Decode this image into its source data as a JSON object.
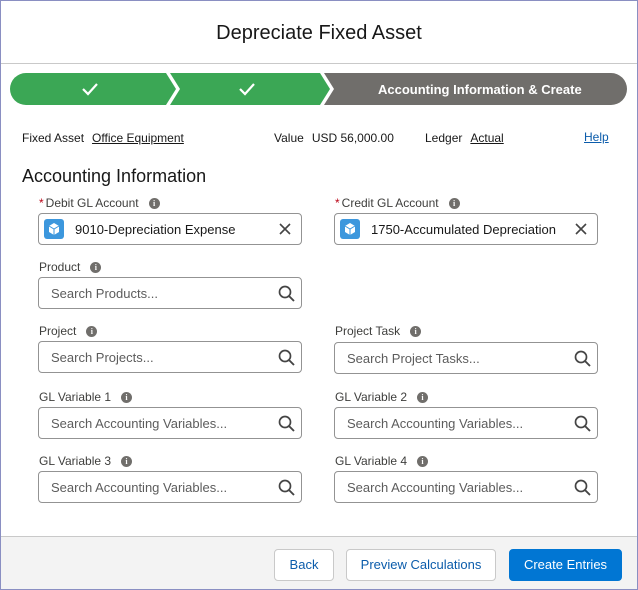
{
  "modal": {
    "title": "Depreciate Fixed Asset"
  },
  "path": {
    "steps": [
      {
        "state": "complete",
        "label": "",
        "icon": "check-icon"
      },
      {
        "state": "complete",
        "label": "",
        "icon": "check-icon"
      },
      {
        "state": "current",
        "label": "Accounting Information & Create"
      }
    ],
    "colors": {
      "complete": "#3ba755",
      "current": "#706e6b"
    }
  },
  "summary": {
    "fixed_asset_label": "Fixed Asset",
    "fixed_asset_value": "Office Equipment",
    "value_label": "Value",
    "value_amount": "USD 56,000.00",
    "ledger_label": "Ledger",
    "ledger_value": "Actual",
    "help_label": "Help"
  },
  "section": {
    "title": "Accounting Information"
  },
  "fields": {
    "debit_gl": {
      "label": "Debit GL Account",
      "required": "*",
      "value": "9010-Depreciation Expense"
    },
    "credit_gl": {
      "label": "Credit GL Account",
      "required": "*",
      "value": "1750-Accumulated Depreciation"
    },
    "product": {
      "label": "Product",
      "placeholder": "Search Products..."
    },
    "project": {
      "label": "Project",
      "placeholder": "Search Projects..."
    },
    "project_task": {
      "label": "Project Task",
      "placeholder": "Search Project Tasks..."
    },
    "gl_var_1": {
      "label": "GL Variable 1",
      "placeholder": "Search Accounting Variables..."
    },
    "gl_var_2": {
      "label": "GL Variable 2",
      "placeholder": "Search Accounting Variables..."
    },
    "gl_var_3": {
      "label": "GL Variable 3",
      "placeholder": "Search Accounting Variables..."
    },
    "gl_var_4": {
      "label": "GL Variable 4",
      "placeholder": "Search Accounting Variables..."
    }
  },
  "footer": {
    "back_label": "Back",
    "preview_label": "Preview Calculations",
    "create_label": "Create Entries"
  },
  "icons": {
    "info": "info-icon",
    "search": "search-icon",
    "clear": "close-icon",
    "object": "cube-icon"
  }
}
